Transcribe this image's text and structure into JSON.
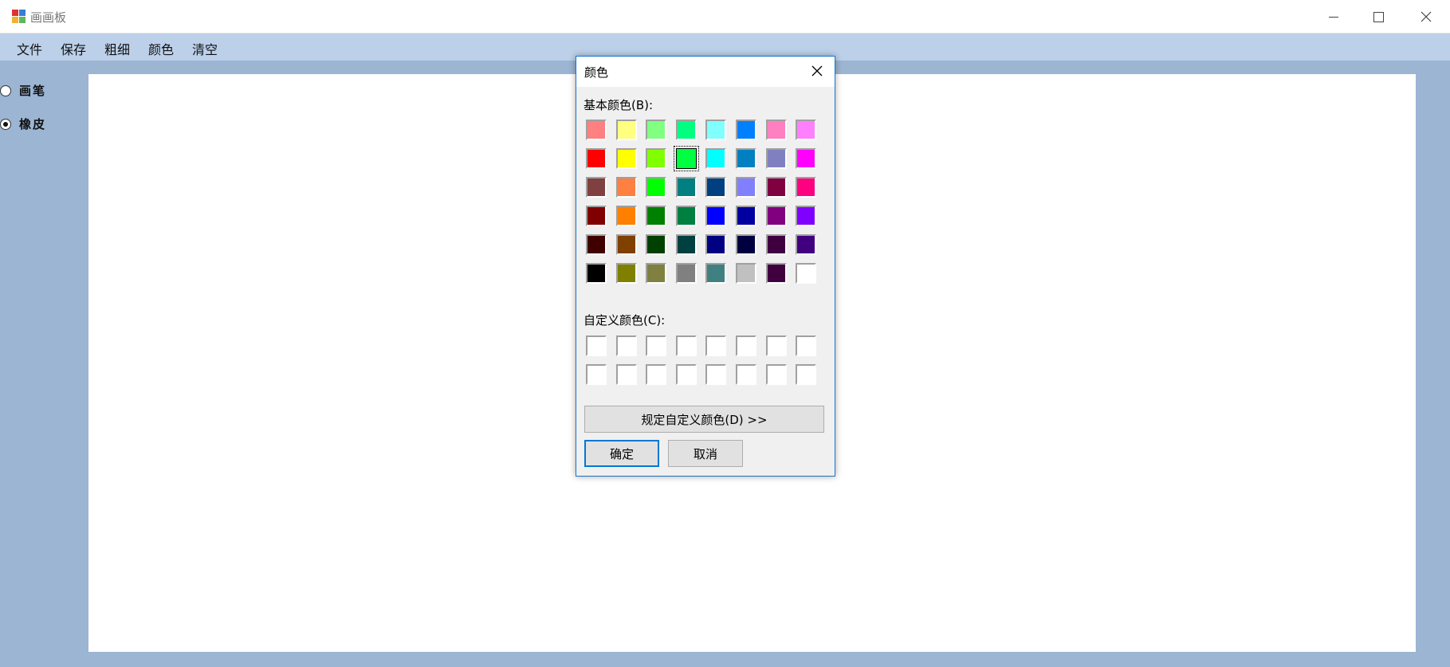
{
  "window": {
    "title": "画画板",
    "controls": {
      "minimize": "minimize",
      "maximize": "maximize",
      "close": "close"
    }
  },
  "menu": {
    "items": [
      {
        "label": "文件"
      },
      {
        "label": "保存"
      },
      {
        "label": "粗细"
      },
      {
        "label": "颜色"
      },
      {
        "label": "清空"
      }
    ]
  },
  "tools": {
    "pen": {
      "label": "画笔",
      "checked": false
    },
    "eraser": {
      "label": "橡皮",
      "checked": true
    }
  },
  "dialog": {
    "title": "颜色",
    "basic_label": "基本颜色(B):",
    "custom_label": "自定义颜色(C):",
    "define_custom_label": "规定自定义颜色(D) >>",
    "ok_label": "确定",
    "cancel_label": "取消",
    "selected_index": 11,
    "basic_colors": [
      "#ff8080",
      "#ffff80",
      "#80ff80",
      "#00ff80",
      "#80ffff",
      "#0080ff",
      "#ff80c0",
      "#ff80ff",
      "#ff0000",
      "#ffff00",
      "#80ff00",
      "#00ff40",
      "#00ffff",
      "#0080c0",
      "#8080c0",
      "#ff00ff",
      "#804040",
      "#ff8040",
      "#00ff00",
      "#008080",
      "#004080",
      "#8080ff",
      "#800040",
      "#ff0080",
      "#800000",
      "#ff8000",
      "#008000",
      "#008040",
      "#0000ff",
      "#0000a0",
      "#800080",
      "#8000ff",
      "#400000",
      "#804000",
      "#004000",
      "#004040",
      "#000080",
      "#000040",
      "#400040",
      "#400080",
      "#000000",
      "#808000",
      "#808040",
      "#808080",
      "#408080",
      "#c0c0c0",
      "#400040",
      "#ffffff"
    ],
    "custom_colors": [
      "#ffffff",
      "#ffffff",
      "#ffffff",
      "#ffffff",
      "#ffffff",
      "#ffffff",
      "#ffffff",
      "#ffffff",
      "#ffffff",
      "#ffffff",
      "#ffffff",
      "#ffffff",
      "#ffffff",
      "#ffffff",
      "#ffffff",
      "#ffffff"
    ]
  }
}
